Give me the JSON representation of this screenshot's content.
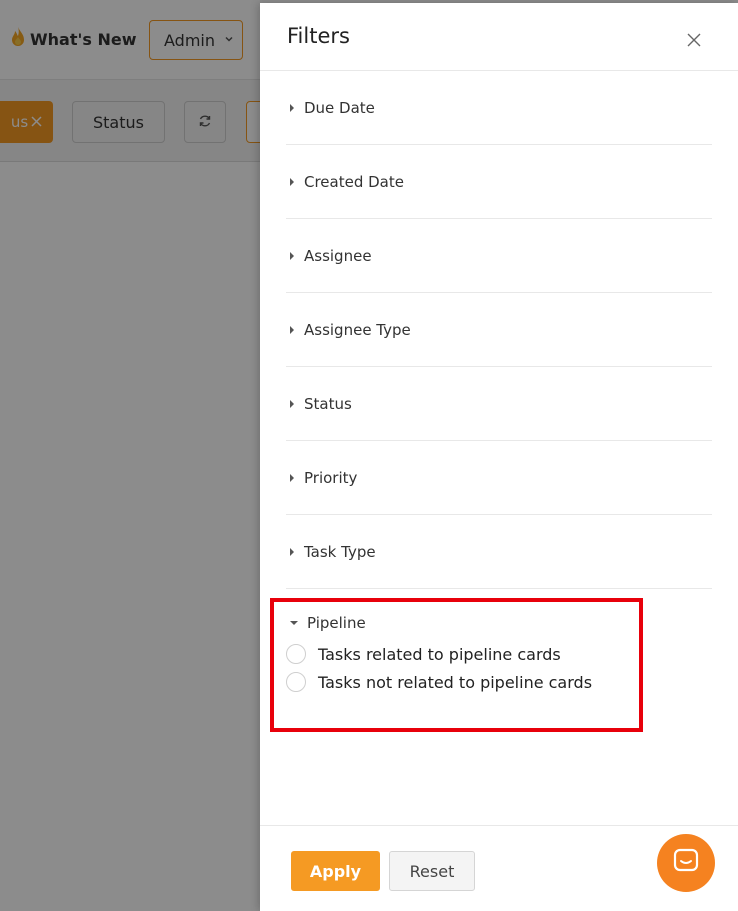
{
  "background": {
    "whats_new_label": "What's New",
    "admin_select_value": "Admin",
    "status_chip_label": "us",
    "status_button_label": "Status"
  },
  "drawer": {
    "title": "Filters",
    "filters": [
      {
        "label": "Due Date"
      },
      {
        "label": "Created Date"
      },
      {
        "label": "Assignee"
      },
      {
        "label": "Assignee Type"
      },
      {
        "label": "Status"
      },
      {
        "label": "Priority"
      },
      {
        "label": "Task Type"
      }
    ],
    "pipeline": {
      "label": "Pipeline",
      "options": [
        {
          "label": "Tasks related to pipeline cards"
        },
        {
          "label": "Tasks not related to pipeline cards"
        }
      ]
    },
    "footer": {
      "apply_label": "Apply",
      "reset_label": "Reset"
    }
  },
  "colors": {
    "accent": "#f59a23",
    "highlight_border": "#e8000b"
  },
  "icons": {
    "close": "close-icon",
    "refresh": "refresh-icon",
    "flame": "flame-icon",
    "chat": "chat-icon"
  }
}
